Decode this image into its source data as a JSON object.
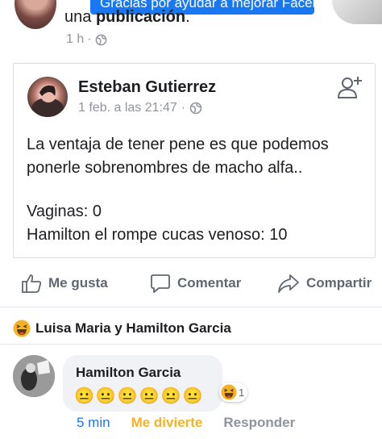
{
  "top_notification": {
    "tooltip_text": "Gracias por ayudar a mejorar Facebook",
    "text_prefix": "una ",
    "text_bold": "publicación",
    "text_suffix": ".",
    "time": "1 h",
    "privacy_icon": "globe-icon"
  },
  "shared_post": {
    "author": "Esteban Gutierrez",
    "date": "1 feb. a las 21:47",
    "privacy_icon": "globe-icon",
    "add_friend_icon": "add-friend-icon",
    "body_line1": "La ventaja de tener pene es que podemos",
    "body_line2": "ponerle sobrenombres de macho alfa..",
    "body_line3": "Vaginas: 0",
    "body_line4": "Hamilton el rompe cucas venoso: 10"
  },
  "actions": {
    "like": "Me gusta",
    "comment": "Comentar",
    "share": "Compartir"
  },
  "reactions_summary": {
    "icon": "haha-icon",
    "text": "Luisa Maria y Hamilton Garcia"
  },
  "comment": {
    "author": "Hamilton Garcia",
    "text": "😐😐😐😐😐😐",
    "reaction_icon": "haha-icon",
    "reaction_count": "1",
    "time": "5 min",
    "my_reaction": "Me divierte",
    "reply": "Responder"
  },
  "colors": {
    "accent": "#1877f2",
    "haha": "#f7b125",
    "muted": "#90949c",
    "divider": "#e4e6eb"
  }
}
